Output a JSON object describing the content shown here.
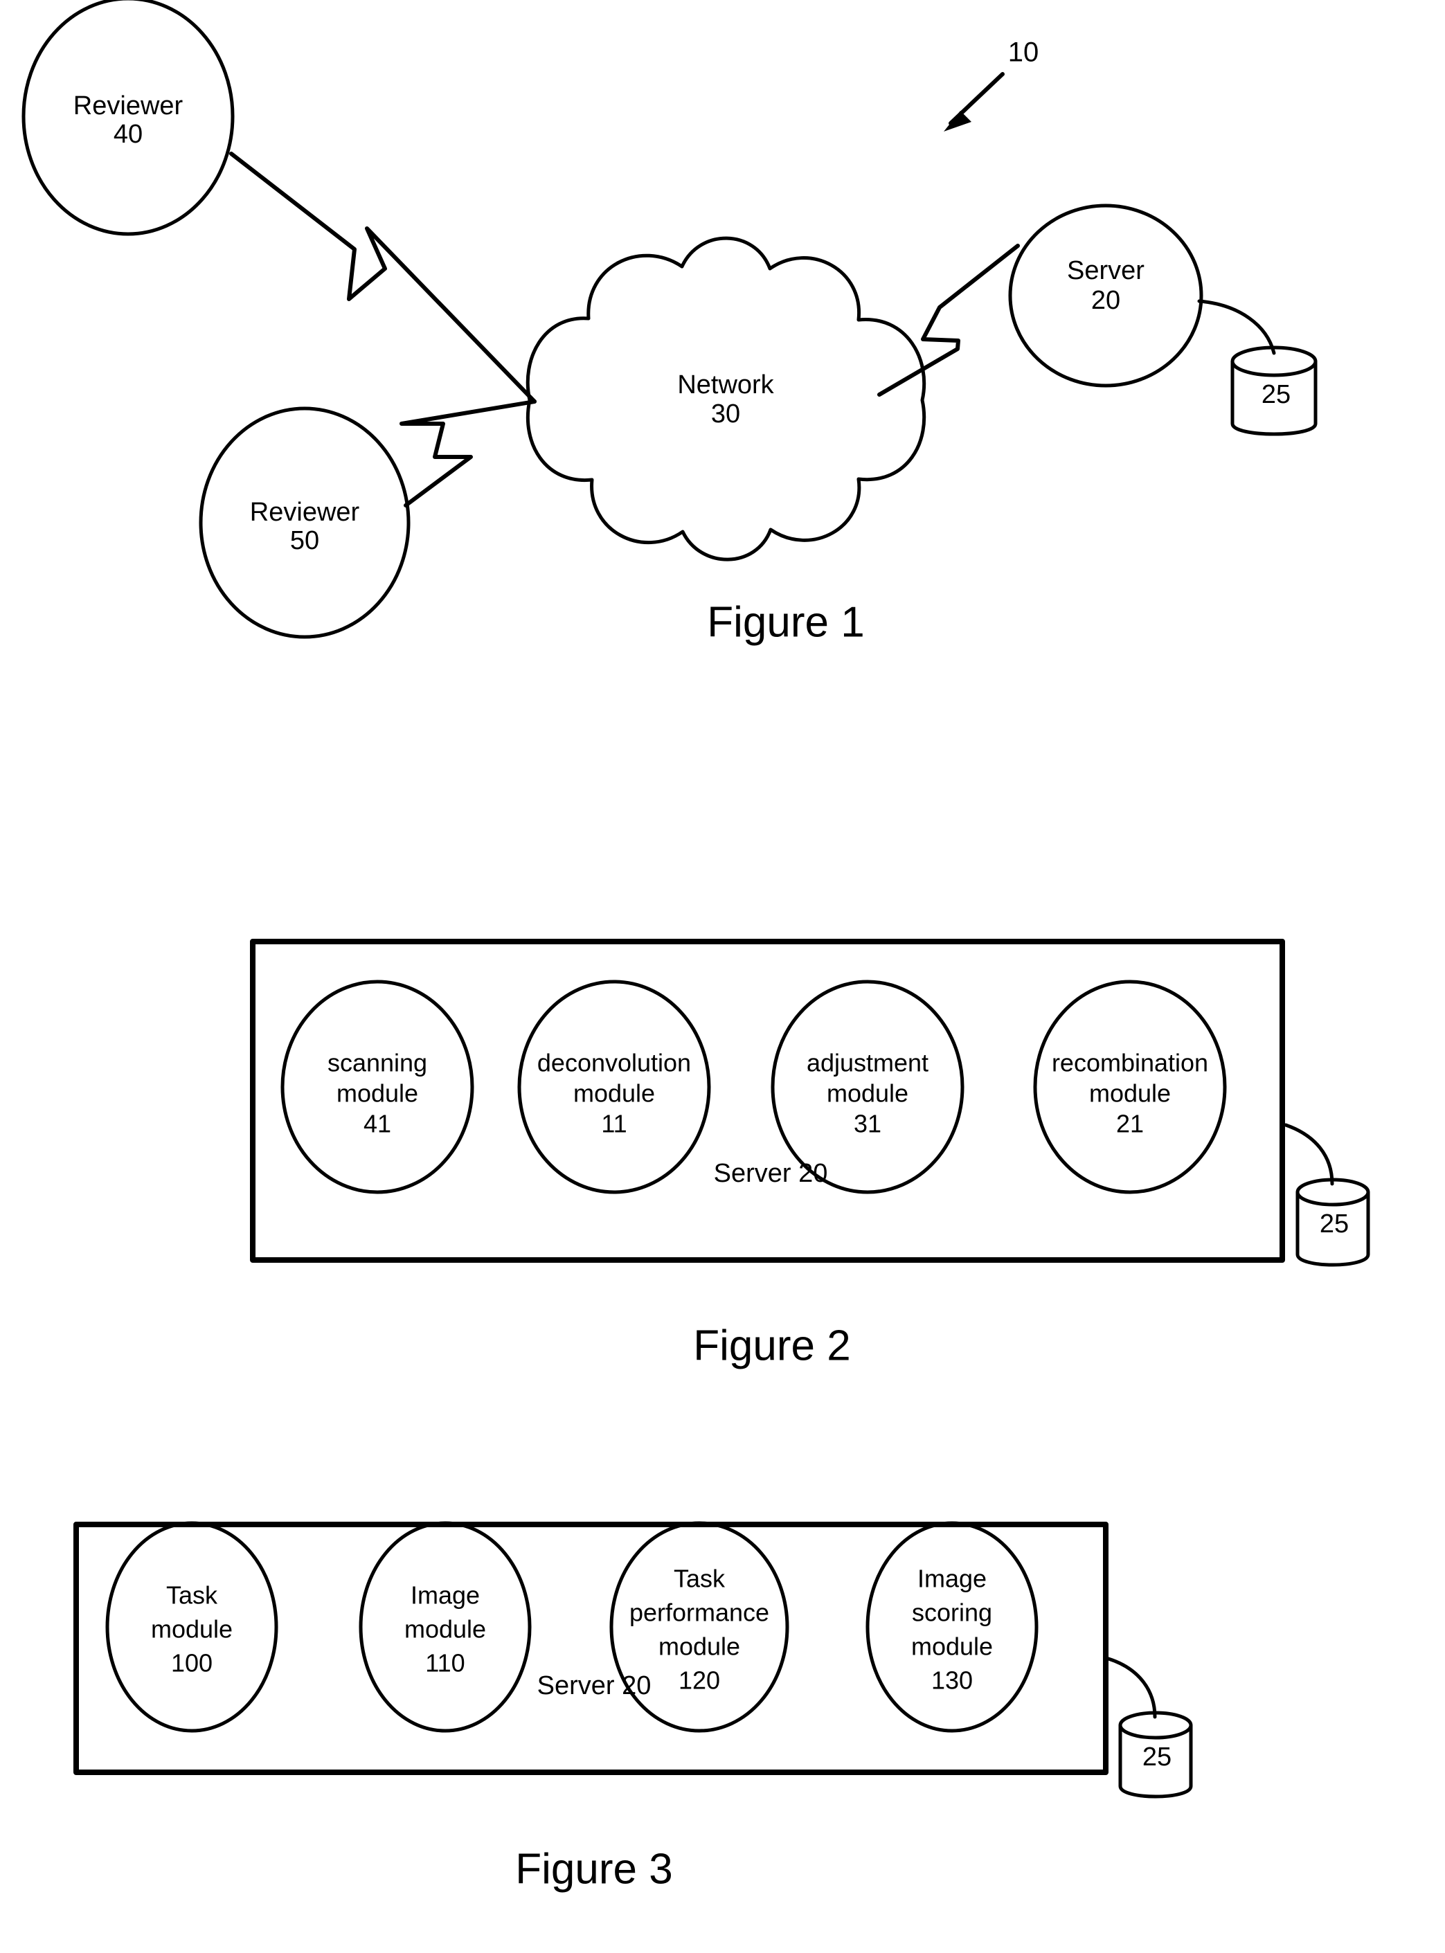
{
  "document": {
    "kind": "patent-drawing-sheet",
    "figures": [
      {
        "id": "figure-1",
        "caption": "Figure 1",
        "system_reference": "10",
        "nodes": [
          {
            "id": "reviewer-40",
            "label_line1": "Reviewer",
            "label_line2": "40"
          },
          {
            "id": "reviewer-50",
            "label_line1": "Reviewer",
            "label_line2": "50"
          },
          {
            "id": "network-30",
            "label_line1": "Network",
            "label_line2": "30"
          },
          {
            "id": "server-20",
            "label_line1": "Server",
            "label_line2": "20"
          },
          {
            "id": "database-25",
            "label_line1": "25"
          }
        ]
      },
      {
        "id": "figure-2",
        "caption": "Figure 2",
        "container_label": "Server 20",
        "database_label": "25",
        "modules": [
          {
            "id": "scanning-module",
            "name_line1": "scanning",
            "name_line2": "module",
            "ref": "41"
          },
          {
            "id": "deconvolution-module",
            "name_line1": "deconvolution",
            "name_line2": "module",
            "ref": "11"
          },
          {
            "id": "adjustment-module",
            "name_line1": "adjustment",
            "name_line2": "module",
            "ref": "31"
          },
          {
            "id": "recombination-module",
            "name_line1": "recombination",
            "name_line2": "module",
            "ref": "21"
          }
        ]
      },
      {
        "id": "figure-3",
        "caption": "Figure 3",
        "container_label": "Server 20",
        "database_label": "25",
        "modules": [
          {
            "id": "task-module",
            "name_line1": "Task",
            "name_line2": "module",
            "name_line3": "",
            "ref": "100"
          },
          {
            "id": "image-module",
            "name_line1": "Image",
            "name_line2": "module",
            "name_line3": "",
            "ref": "110"
          },
          {
            "id": "task-performance-module",
            "name_line1": "Task",
            "name_line2": "performance",
            "name_line3": "module",
            "ref": "120"
          },
          {
            "id": "image-scoring-module",
            "name_line1": "Image",
            "name_line2": "scoring",
            "name_line3": "module",
            "ref": "130"
          }
        ]
      }
    ]
  },
  "colors": {
    "ink": "#000000",
    "paper": "#ffffff"
  }
}
